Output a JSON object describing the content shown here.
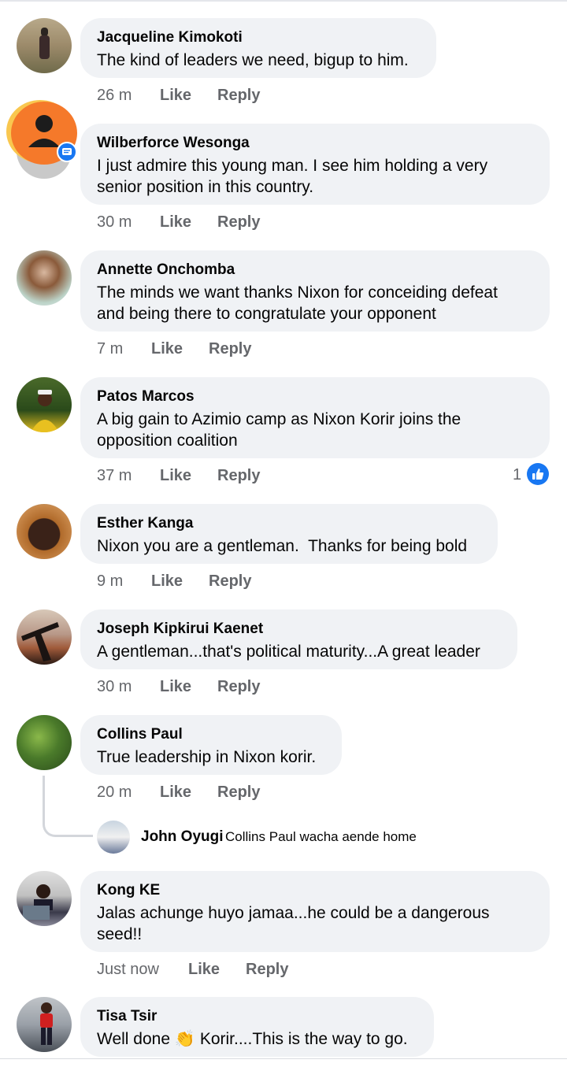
{
  "comments": [
    {
      "name": "Jacqueline Kimokoti",
      "text": [
        "The kind of leaders we need, bigup to him."
      ],
      "time": "26 m",
      "like": "Like",
      "reply": "Reply"
    },
    {
      "name": "Wilberforce Wesonga",
      "text": [
        "I just admire this young man. I see him holding a very",
        "senior position in this country."
      ],
      "time": "30 m",
      "like": "Like",
      "reply": "Reply"
    },
    {
      "name": "Annette Onchomba",
      "text": [
        "The minds we want thanks Nixon for conceiding defeat",
        "and being there to congratulate your opponent"
      ],
      "time": "7 m",
      "like": "Like",
      "reply": "Reply"
    },
    {
      "name": "Patos Marcos",
      "text": [
        "A big gain to Azimio camp as Nixon Korir joins the",
        "opposition coalition"
      ],
      "time": "37 m",
      "like": "Like",
      "reply": "Reply",
      "reactions": "1"
    },
    {
      "name": "Esther Kanga",
      "text": [
        "Nixon you are a gentleman.  Thanks for being bold"
      ],
      "time": "9 m",
      "like": "Like",
      "reply": "Reply"
    },
    {
      "name": "Joseph Kipkirui Kaenet",
      "text": [
        "A gentleman...that's political maturity...A great leader"
      ],
      "time": "30 m",
      "like": "Like",
      "reply": "Reply"
    },
    {
      "name": "Collins Paul",
      "text": [
        "True leadership in Nixon korir."
      ],
      "time": "20 m",
      "like": "Like",
      "reply": "Reply"
    },
    {
      "name": "Kong KE",
      "text": [
        "Jalas achunge huyo jamaa...he could be a dangerous",
        "seed!!"
      ],
      "time": "Just now",
      "like": "Like",
      "reply": "Reply"
    },
    {
      "name": "Tisa Tsir",
      "text_before": "Well done ",
      "emoji": "👏",
      "text_after": " Korir....This is the way to go."
    }
  ],
  "nested_reply": {
    "name": "John Oyugi",
    "text": "Collins Paul wacha aende home"
  },
  "colors": {
    "bubble": "#f0f2f5",
    "meta": "#65676b",
    "like_blue": "#1877f2",
    "chat_head": "#f5792a"
  },
  "icons": {
    "like_reaction": "thumbs-up-icon",
    "chat_head": "person-icon",
    "chat_badge": "message-icon",
    "clap": "clapping-hands"
  }
}
